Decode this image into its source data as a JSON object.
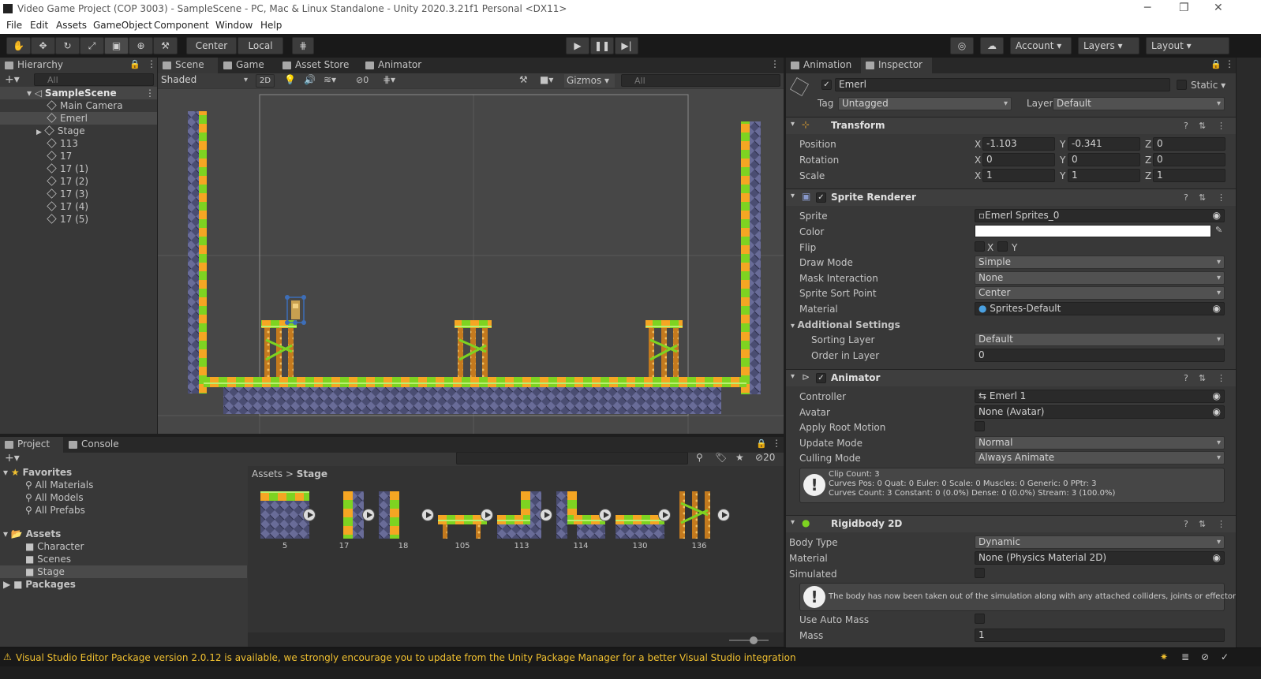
{
  "window": {
    "title": "Video Game Project (COP 3003) - SampleScene - PC, Mac & Linux Standalone - Unity 2020.3.21f1 Personal <DX11>"
  },
  "menu": [
    "File",
    "Edit",
    "Assets",
    "GameObject",
    "Component",
    "Window",
    "Help"
  ],
  "toolbar": {
    "center": "Center",
    "local": "Local",
    "account": "Account",
    "layers": "Layers",
    "layout": "Layout"
  },
  "hierarchy": {
    "tab": "Hierarchy",
    "search_placeholder": "All",
    "scene": "SampleScene",
    "items": [
      "Main Camera",
      "Emerl",
      "Stage",
      "113",
      "17",
      "17 (1)",
      "17 (2)",
      "17 (3)",
      "17 (4)",
      "17 (5)"
    ]
  },
  "scene_tabs": [
    "Scene",
    "Game",
    "Asset Store",
    "Animator"
  ],
  "scene_toolbar": {
    "shading": "Shaded",
    "mode2d": "2D",
    "hidden_count": "0",
    "gizmos": "Gizmos",
    "search_placeholder": "All"
  },
  "project": {
    "tabs": [
      "Project",
      "Console"
    ],
    "hidden_count": "20",
    "favorites": "Favorites",
    "fav_items": [
      "All Materials",
      "All Models",
      "All Prefabs"
    ],
    "assets": "Assets",
    "asset_folders": [
      "Character",
      "Scenes",
      "Stage"
    ],
    "packages": "Packages",
    "breadcrumb_root": "Assets",
    "breadcrumb_current": "Stage",
    "asset_items": [
      "5",
      "17",
      "18",
      "105",
      "113",
      "114",
      "130",
      "136"
    ]
  },
  "inspector": {
    "tabs": [
      "Animation",
      "Inspector"
    ],
    "object_name": "Emerl",
    "static_label": "Static",
    "tag_label": "Tag",
    "tag_value": "Untagged",
    "layer_label": "Layer",
    "layer_value": "Default",
    "transform": {
      "title": "Transform",
      "rows": [
        {
          "label": "Position",
          "x": "-1.103",
          "y": "-0.341",
          "z": "0"
        },
        {
          "label": "Rotation",
          "x": "0",
          "y": "0",
          "z": "0"
        },
        {
          "label": "Scale",
          "x": "1",
          "y": "1",
          "z": "1"
        }
      ]
    },
    "sprite_renderer": {
      "title": "Sprite Renderer",
      "sprite_label": "Sprite",
      "sprite": "Emerl Sprites_0",
      "color_label": "Color",
      "flip_label": "Flip",
      "flip_x": "X",
      "flip_y": "Y",
      "draw_mode_label": "Draw Mode",
      "draw_mode": "Simple",
      "mask_label": "Mask Interaction",
      "mask": "None",
      "sort_point_label": "Sprite Sort Point",
      "sort_point": "Center",
      "material_label": "Material",
      "material": "Sprites-Default",
      "additional": "Additional Settings",
      "sorting_layer_label": "Sorting Layer",
      "sorting_layer": "Default",
      "order_label": "Order in Layer",
      "order": "0"
    },
    "animator": {
      "title": "Animator",
      "controller_label": "Controller",
      "controller": "Emerl 1",
      "avatar_label": "Avatar",
      "avatar": "None (Avatar)",
      "root_motion_label": "Apply Root Motion",
      "update_label": "Update Mode",
      "update": "Normal",
      "culling_label": "Culling Mode",
      "culling": "Always Animate",
      "info1": "Clip Count: 3",
      "info2": "Curves Pos: 0 Quat: 0 Euler: 0 Scale: 0 Muscles: 0 Generic: 0 PPtr: 3",
      "info3": "Curves Count: 3 Constant: 0 (0.0%) Dense: 0 (0.0%) Stream: 3 (100.0%)"
    },
    "rigidbody": {
      "title": "Rigidbody 2D",
      "body_type_label": "Body Type",
      "body_type": "Dynamic",
      "material_label": "Material",
      "material": "None (Physics Material 2D)",
      "simulated_label": "Simulated",
      "note": "The body has now been taken out of the simulation along with any attached colliders, joints or effectors.",
      "auto_mass_label": "Use Auto Mass",
      "mass_label": "Mass",
      "mass": "1"
    }
  },
  "status": {
    "message": "Visual Studio Editor Package version 2.0.12 is available, we strongly encourage you to update from the Unity Package Manager for a better Visual Studio integration"
  },
  "colors": {
    "accent": "#3d6eb8",
    "warning": "#f0c030",
    "tile_green": "#7ed321",
    "tile_orange": "#f5a623",
    "stone": "#4a4d72"
  }
}
